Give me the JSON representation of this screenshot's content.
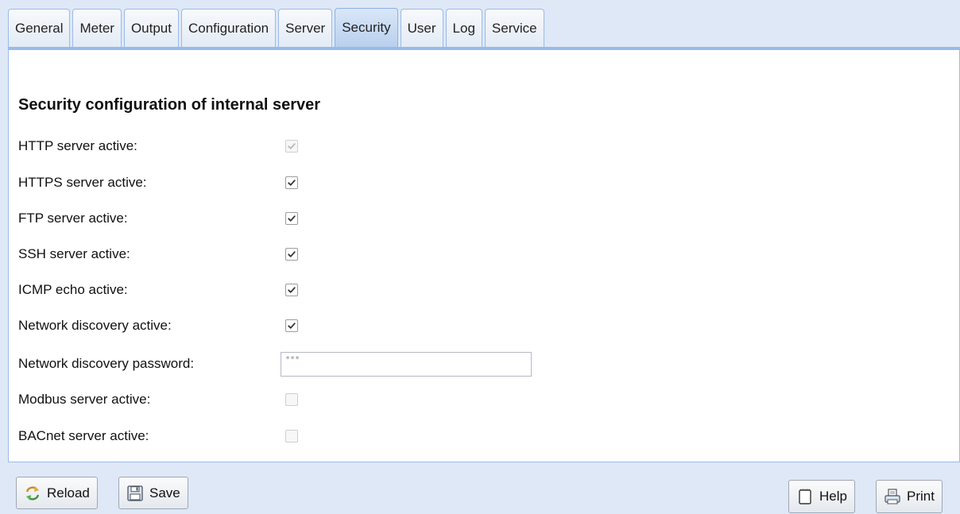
{
  "tabs": [
    {
      "label": "General",
      "active": false
    },
    {
      "label": "Meter",
      "active": false
    },
    {
      "label": "Output",
      "active": false
    },
    {
      "label": "Configuration",
      "active": false
    },
    {
      "label": "Server",
      "active": false
    },
    {
      "label": "Security",
      "active": true
    },
    {
      "label": "User",
      "active": false
    },
    {
      "label": "Log",
      "active": false
    },
    {
      "label": "Service",
      "active": false
    }
  ],
  "section": {
    "title": "Security configuration of internal server"
  },
  "fields": {
    "http": {
      "label": "HTTP server active:",
      "checked": true,
      "disabled": true
    },
    "https": {
      "label": "HTTPS server active:",
      "checked": true,
      "disabled": false
    },
    "ftp": {
      "label": "FTP server active:",
      "checked": true,
      "disabled": false
    },
    "ssh": {
      "label": "SSH server active:",
      "checked": true,
      "disabled": false
    },
    "icmp": {
      "label": "ICMP echo active:",
      "checked": true,
      "disabled": false
    },
    "discovery": {
      "label": "Network discovery active:",
      "checked": true,
      "disabled": false
    },
    "discovery_password": {
      "label": "Network discovery password:",
      "value": "***"
    },
    "modbus": {
      "label": "Modbus server active:",
      "checked": false,
      "disabled": true
    },
    "bacnet": {
      "label": "BACnet server active:",
      "checked": false,
      "disabled": true
    }
  },
  "toolbar": {
    "reload_label": "Reload",
    "save_label": "Save",
    "help_label": "Help",
    "print_label": "Print"
  },
  "colors": {
    "background": "#dfe8f6",
    "border": "#99bbe8",
    "active_tab": "#b9d0ee"
  }
}
